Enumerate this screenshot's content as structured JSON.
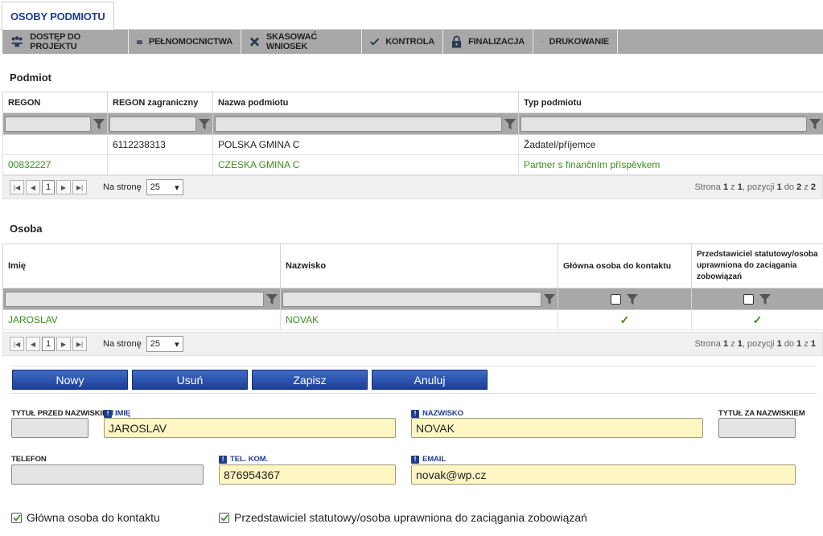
{
  "tab": {
    "label": "OSOBY PODMIOTU"
  },
  "toolbar": [
    {
      "label": "DOSTĘP DO PROJEKTU",
      "icon": "people-icon"
    },
    {
      "label": "PEŁNOMOCNICTWA",
      "icon": "envelope-icon"
    },
    {
      "label": "SKASOWAĆ WNIOSEK",
      "icon": "x-icon"
    },
    {
      "label": "KONTROLA",
      "icon": "check-icon"
    },
    {
      "label": "FINALIZACJA",
      "icon": "lock-icon"
    },
    {
      "label": "DRUKOWANIE",
      "icon": "printer-icon"
    }
  ],
  "podmiot": {
    "title": "Podmiot",
    "columns": [
      "REGON",
      "REGON zagraniczny",
      "Nazwa podmiotu",
      "Typ podmiotu"
    ],
    "rows": [
      [
        "",
        "6112238313",
        "POLSKA GMINA C",
        "Žadatel/příjemce"
      ],
      [
        "00832227",
        "",
        "CZESKA GMINA C",
        "Partner s finančním příspěvkem"
      ]
    ],
    "pager": {
      "page": "1",
      "per_page_label": "Na stronę",
      "per_page": "25",
      "info": {
        "prefix": "Strona",
        "page": "1",
        "of": "z",
        "pages": "1",
        "items_label": ", pozycji",
        "from": "1",
        "to_label": "do",
        "to": "2",
        "of2": "z",
        "total": "2"
      }
    }
  },
  "osoba": {
    "title": "Osoba",
    "columns": [
      "Imię",
      "Nazwisko",
      "Główna osoba do kontaktu",
      "Przedstawiciel statutowy/osoba uprawniona do zaciągania zobowiązań"
    ],
    "rows": [
      [
        "JAROSLAV",
        "NOVAK",
        "✓",
        "✓"
      ]
    ],
    "pager": {
      "page": "1",
      "per_page_label": "Na stronę",
      "per_page": "25",
      "info": {
        "prefix": "Strona",
        "page": "1",
        "of": "z",
        "pages": "1",
        "items_label": ", pozycji",
        "from": "1",
        "to_label": "do",
        "to": "1",
        "of2": "z",
        "total": "1"
      }
    }
  },
  "actions": {
    "new": "Nowy",
    "delete": "Usuń",
    "save": "Zapisz",
    "cancel": "Anuluj"
  },
  "form": {
    "title_before_label": "TYTUŁ PRZED NAZWISKIEM",
    "title_before_value": "",
    "first_name_label": "IMIĘ",
    "first_name_value": "JAROSLAV",
    "last_name_label": "NAZWISKO",
    "last_name_value": "NOVAK",
    "title_after_label": "TYTUŁ ZA NAZWISKIEM",
    "title_after_value": "",
    "phone_label": "TELEFON",
    "phone_value": "",
    "mobile_label": "TEL. KOM.",
    "mobile_value": "876954367",
    "email_label": "EMAIL",
    "email_value": "novak@wp.cz",
    "main_contact_label": "Główna osoba do kontaktu",
    "main_contact_checked": true,
    "statutory_label": "Przedstawiciel statutowy/osoba uprawniona do zaciągania zobowiązań",
    "statutory_checked": true
  },
  "colors": {
    "accent": "#1d3d8f",
    "selected_row_text": "#3a8f1a",
    "required_field": "#fdf6c2",
    "toolbar": "#a8a8a8"
  }
}
